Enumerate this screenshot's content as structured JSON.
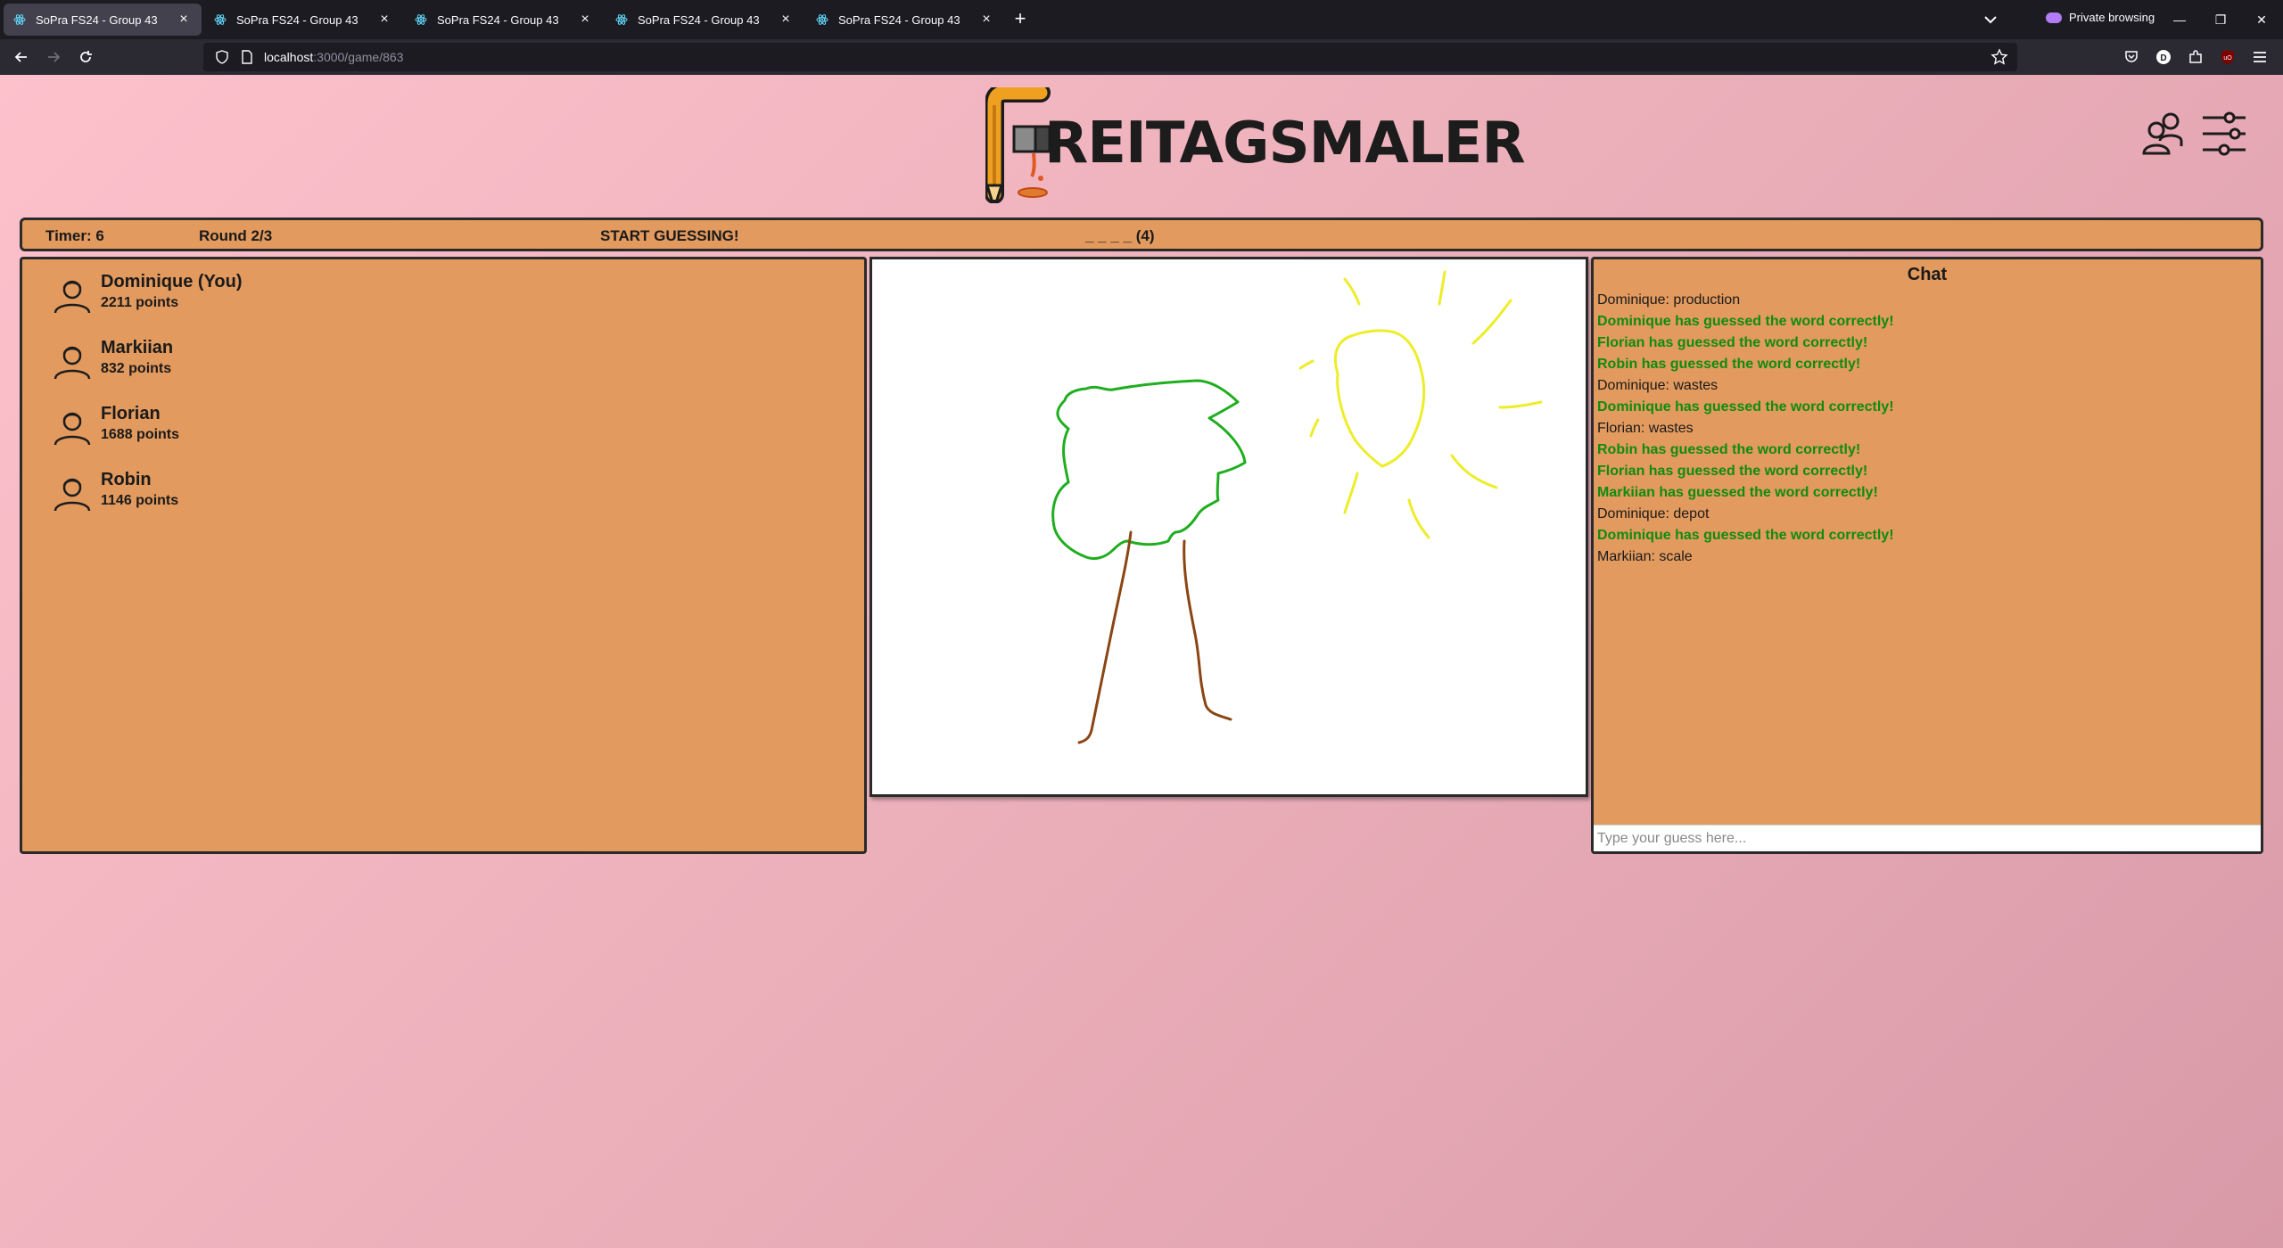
{
  "browser": {
    "tabs": [
      {
        "title": "SoPra FS24 - Group 43",
        "active": true
      },
      {
        "title": "SoPra FS24 - Group 43",
        "active": false
      },
      {
        "title": "SoPra FS24 - Group 43",
        "active": false
      },
      {
        "title": "SoPra FS24 - Group 43",
        "active": false
      },
      {
        "title": "SoPra FS24 - Group 43",
        "active": false
      }
    ],
    "private_label": "Private browsing",
    "url_host": "localhost",
    "url_path": ":3000/game/863"
  },
  "app": {
    "logo_text": "REITAGSMALER",
    "info": {
      "timer": "Timer: 6",
      "round": "Round 2/3",
      "status": "START GUESSING!",
      "word_hint": "_ _ _ _ (4)"
    },
    "players": [
      {
        "name": "Dominique (You)",
        "points": "2211 points"
      },
      {
        "name": "Markiian",
        "points": "832 points"
      },
      {
        "name": "Florian",
        "points": "1688 points"
      },
      {
        "name": "Robin",
        "points": "1146 points"
      }
    ],
    "chat": {
      "title": "Chat",
      "messages": [
        {
          "text": "Dominique: production",
          "correct": false
        },
        {
          "text": "Dominique has guessed the word correctly!",
          "correct": true
        },
        {
          "text": "Florian has guessed the word correctly!",
          "correct": true
        },
        {
          "text": "Robin has guessed the word correctly!",
          "correct": true
        },
        {
          "text": "Dominique: wastes",
          "correct": false
        },
        {
          "text": "Dominique has guessed the word correctly!",
          "correct": true
        },
        {
          "text": "Florian: wastes",
          "correct": false
        },
        {
          "text": "Robin has guessed the word correctly!",
          "correct": true
        },
        {
          "text": "Florian has guessed the word correctly!",
          "correct": true
        },
        {
          "text": "Markiian has guessed the word correctly!",
          "correct": true
        },
        {
          "text": "Dominique: depot",
          "correct": false
        },
        {
          "text": "Dominique has guessed the word correctly!",
          "correct": true
        },
        {
          "text": "Markiian: scale",
          "correct": false
        }
      ],
      "input_placeholder": "Type your guess here...",
      "correct_color": "#0f8c0f"
    },
    "colors": {
      "panel": "#e29a5e",
      "border": "#2a2a2a",
      "tree_leaves": "#1fae1f",
      "tree_trunk": "#8b4513",
      "sun": "#eded2a"
    }
  }
}
